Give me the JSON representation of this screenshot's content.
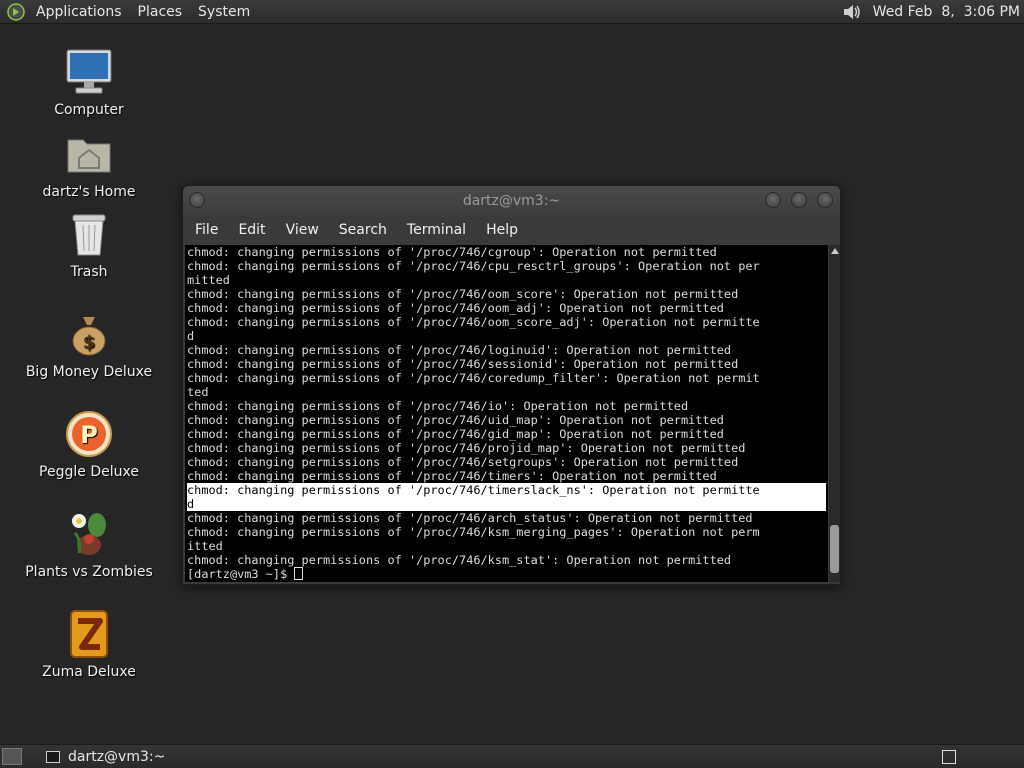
{
  "top_panel": {
    "menus": [
      "Applications",
      "Places",
      "System"
    ],
    "datetime": "Wed Feb  8,  3:06 PM",
    "volume_icon": "volume-icon"
  },
  "desktop_icons": [
    {
      "label": "Computer",
      "icon": "computer-icon"
    },
    {
      "label": "dartz's Home",
      "icon": "home-folder-icon"
    },
    {
      "label": "Trash",
      "icon": "trash-icon"
    },
    {
      "label": "Big Money Deluxe",
      "icon": "money-bag-icon"
    },
    {
      "label": "Peggle Deluxe",
      "icon": "peggle-icon"
    },
    {
      "label": "Plants vs Zombies",
      "icon": "plants-vs-zombies-icon"
    },
    {
      "label": "Zuma Deluxe",
      "icon": "zuma-icon"
    }
  ],
  "terminal": {
    "title": "dartz@vm3:~",
    "menu": [
      "File",
      "Edit",
      "View",
      "Search",
      "Terminal",
      "Help"
    ],
    "lines": [
      "chmod: changing permissions of '/proc/746/cgroup': Operation not permitted",
      "chmod: changing permissions of '/proc/746/cpu_resctrl_groups': Operation not per",
      "mitted",
      "chmod: changing permissions of '/proc/746/oom_score': Operation not permitted",
      "chmod: changing permissions of '/proc/746/oom_adj': Operation not permitted",
      "chmod: changing permissions of '/proc/746/oom_score_adj': Operation not permitte",
      "d",
      "chmod: changing permissions of '/proc/746/loginuid': Operation not permitted",
      "chmod: changing permissions of '/proc/746/sessionid': Operation not permitted",
      "chmod: changing permissions of '/proc/746/coredump_filter': Operation not permit",
      "ted",
      "chmod: changing permissions of '/proc/746/io': Operation not permitted",
      "chmod: changing permissions of '/proc/746/uid_map': Operation not permitted",
      "chmod: changing permissions of '/proc/746/gid_map': Operation not permitted",
      "chmod: changing permissions of '/proc/746/projid_map': Operation not permitted",
      "chmod: changing permissions of '/proc/746/setgroups': Operation not permitted",
      "chmod: changing permissions of '/proc/746/timers': Operation not permitted",
      "chmod: changing permissions of '/proc/746/timerslack_ns': Operation not permitte",
      "d",
      "chmod: changing permissions of '/proc/746/arch_status': Operation not permitted",
      "chmod: changing permissions of '/proc/746/ksm_merging_pages': Operation not perm",
      "itted",
      "chmod: changing permissions of '/proc/746/ksm_stat': Operation not permitted"
    ],
    "highlighted_lines": [
      17,
      18
    ],
    "prompt": "[dartz@vm3 ~]$ "
  },
  "bottom_panel": {
    "task_label": "dartz@vm3:~"
  }
}
